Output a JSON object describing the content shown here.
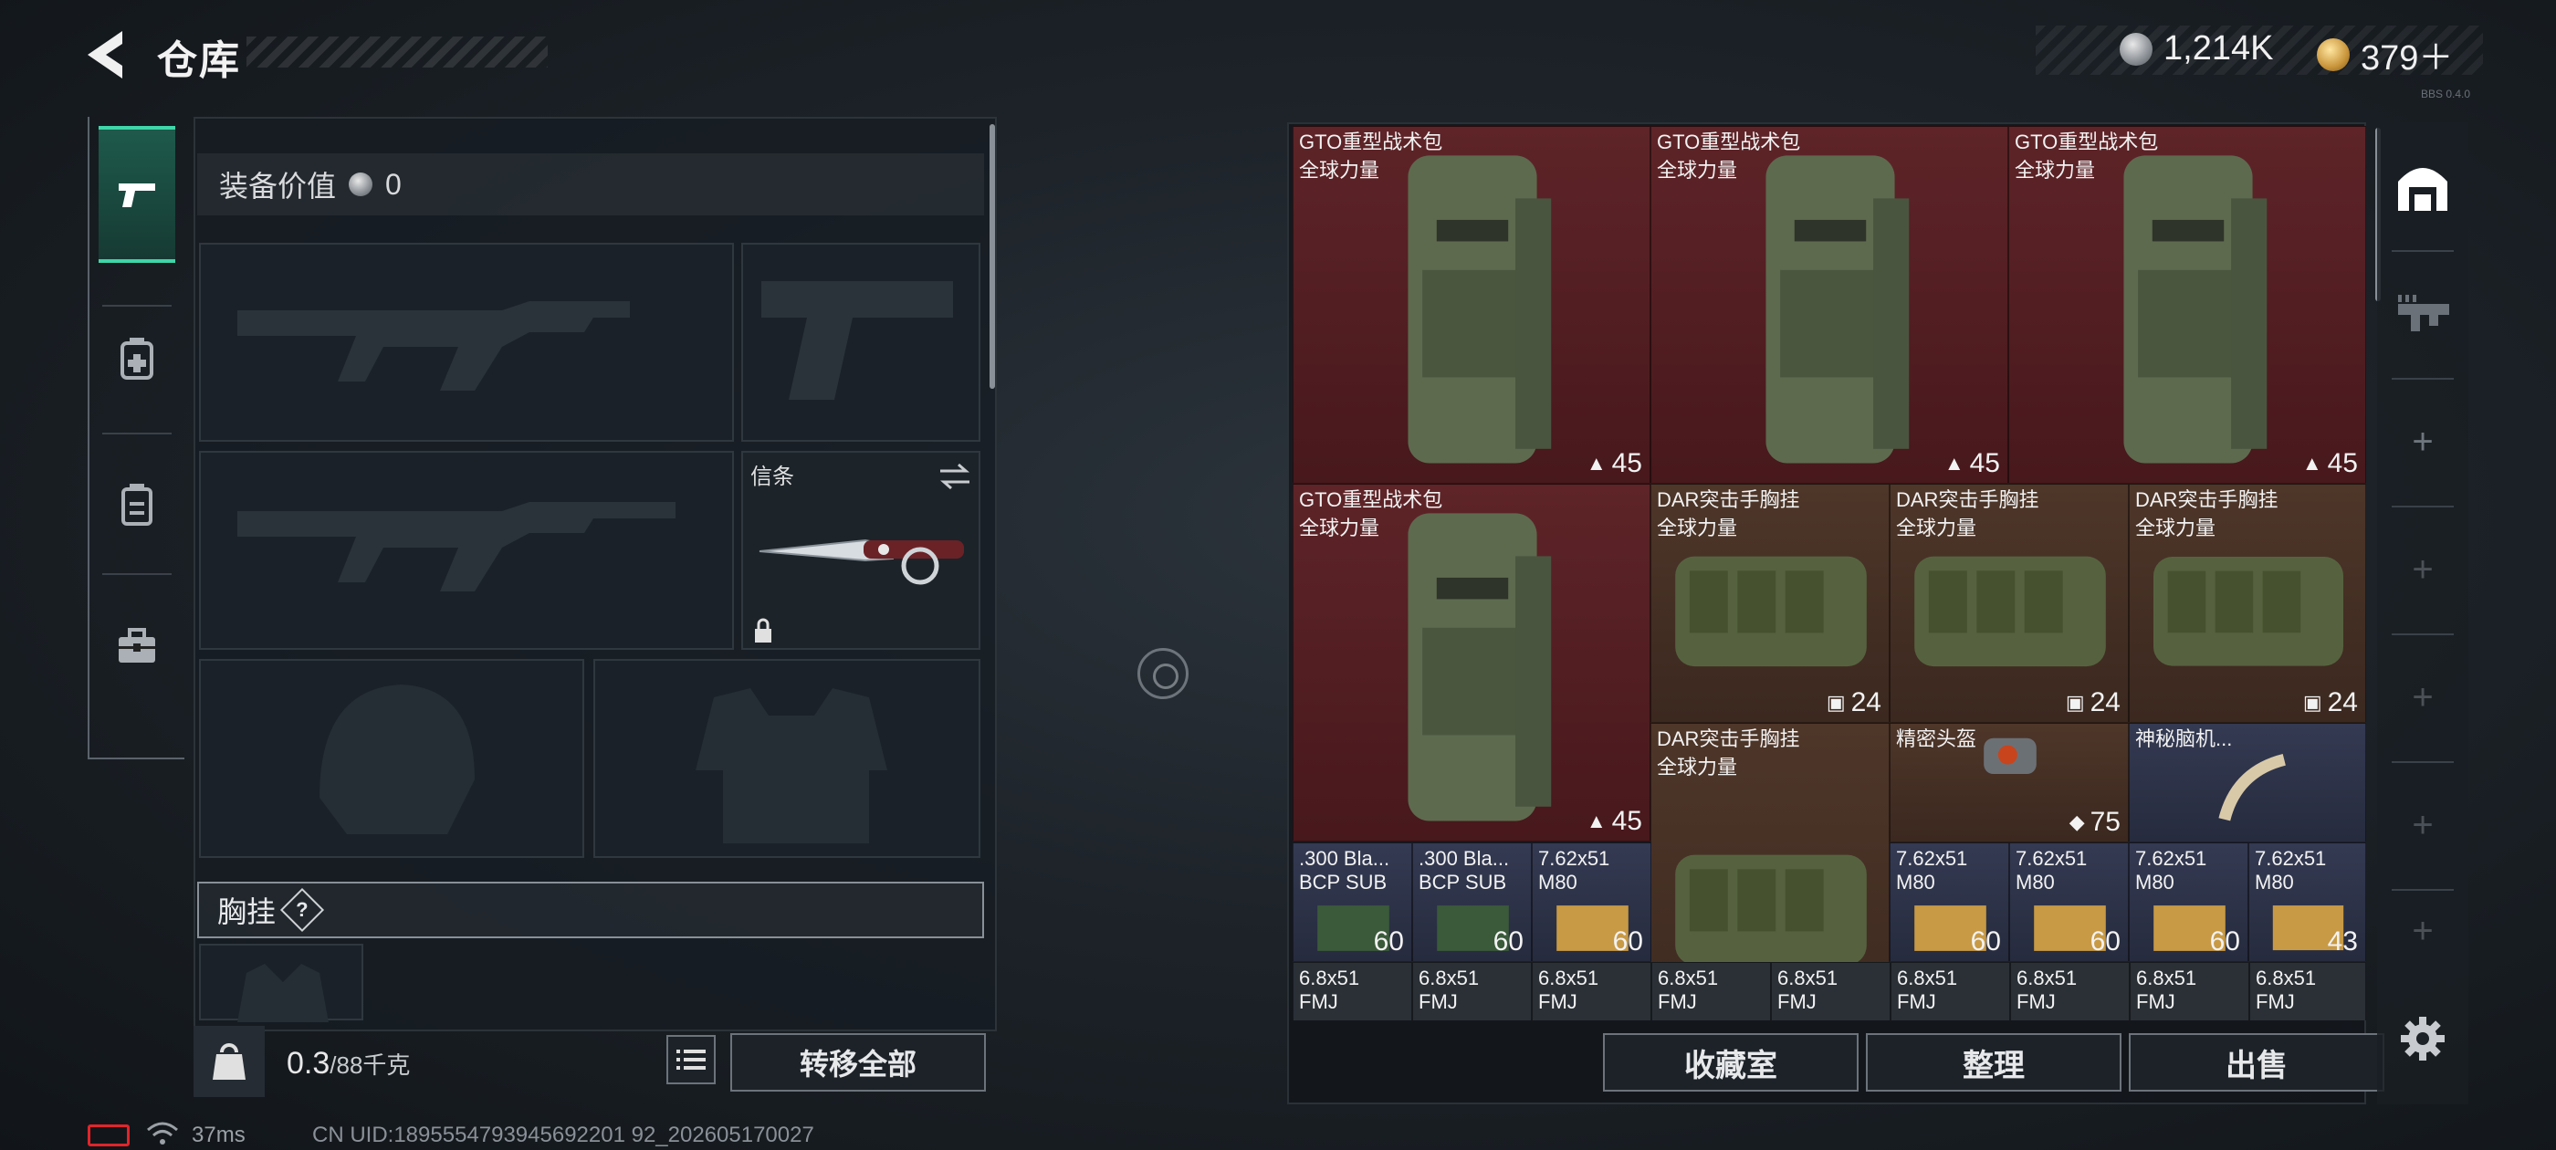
{
  "header": {
    "title": "仓库",
    "currency": [
      {
        "icon": "silver-coin-icon",
        "value": "1,214K"
      },
      {
        "icon": "gold-coin-icon",
        "value": "379＋"
      }
    ],
    "version": "BBS 0.4.0"
  },
  "left_nav": [
    {
      "icon": "pistol-icon",
      "active": true
    },
    {
      "icon": "medkit-bag-icon",
      "active": false
    },
    {
      "icon": "backpack-icon",
      "active": false
    },
    {
      "icon": "toolbox-icon",
      "active": false
    }
  ],
  "loadout": {
    "equip_value_label": "装备价值",
    "equip_value": "0",
    "melee_label": "信条",
    "chest_rig_label": "胸挂",
    "help_mark": "?",
    "weight_current": "0.3",
    "weight_capacity": "/88千克",
    "transfer_all": "转移全部"
  },
  "storage": {
    "items": [
      {
        "name": "GTO重型战术包",
        "sub": "全球力量",
        "count": "45",
        "count_icon": "backpack-capacity-icon",
        "bg": "red"
      },
      {
        "name": "GTO重型战术包",
        "sub": "全球力量",
        "count": "45",
        "count_icon": "backpack-capacity-icon",
        "bg": "red"
      },
      {
        "name": "GTO重型战术包",
        "sub": "全球力量",
        "count": "45",
        "count_icon": "backpack-capacity-icon",
        "bg": "red"
      },
      {
        "name": "GTO重型战术包",
        "sub": "全球力量",
        "count": "45",
        "count_icon": "backpack-capacity-icon",
        "bg": "red"
      },
      {
        "name": "DAR突击手胸挂",
        "sub": "全球力量",
        "count": "24",
        "count_icon": "vest-capacity-icon",
        "bg": "brown"
      },
      {
        "name": "DAR突击手胸挂",
        "sub": "全球力量",
        "count": "24",
        "count_icon": "vest-capacity-icon",
        "bg": "brown"
      },
      {
        "name": "DAR突击手胸挂",
        "sub": "全球力量",
        "count": "24",
        "count_icon": "vest-capacity-icon",
        "bg": "brown"
      },
      {
        "name": "DAR突击手胸挂",
        "sub": "全球力量",
        "count": "24",
        "count_icon": "vest-capacity-icon",
        "bg": "brown"
      },
      {
        "name": "精密头盔",
        "sub": "",
        "count": "75",
        "count_icon": "armor-durability-icon",
        "bg": "brown"
      },
      {
        "name": "神秘脑机...",
        "sub": "",
        "count": "",
        "count_icon": "",
        "bg": "blue"
      },
      {
        "name": ".300 Bla...",
        "sub": "BCP SUB",
        "count": "60",
        "bg": "blue"
      },
      {
        "name": ".300 Bla...",
        "sub": "BCP SUB",
        "count": "60",
        "bg": "blue"
      },
      {
        "name": "7.62x51",
        "sub": "M80",
        "count": "60",
        "bg": "blue"
      },
      {
        "name": "7.62x51",
        "sub": "M80",
        "count": "60",
        "bg": "blue"
      },
      {
        "name": "7.62x51",
        "sub": "M80",
        "count": "60",
        "bg": "blue"
      },
      {
        "name": "7.62x51",
        "sub": "M80",
        "count": "60",
        "bg": "blue"
      },
      {
        "name": "7.62x51",
        "sub": "M80",
        "count": "43",
        "bg": "blue"
      },
      {
        "name": "6.8x51",
        "sub": "FMJ",
        "bg": "gray"
      },
      {
        "name": "6.8x51",
        "sub": "FMJ",
        "bg": "gray"
      },
      {
        "name": "6.8x51",
        "sub": "FMJ",
        "bg": "gray"
      },
      {
        "name": "6.8x51",
        "sub": "FMJ",
        "bg": "gray"
      },
      {
        "name": "6.8x51",
        "sub": "FMJ",
        "bg": "gray"
      },
      {
        "name": "6.8x51",
        "sub": "FMJ",
        "bg": "gray"
      },
      {
        "name": "6.8x51",
        "sub": "FMJ",
        "bg": "gray"
      },
      {
        "name": "6.8x51",
        "sub": "FMJ",
        "bg": "gray"
      },
      {
        "name": "6.8x51",
        "sub": "FMJ",
        "bg": "gray"
      }
    ],
    "buttons": [
      "收藏室",
      "整理",
      "出售"
    ]
  },
  "right_rail": [
    {
      "icon": "warehouse-icon",
      "active": true
    },
    {
      "icon": "weapon-rack-icon",
      "active": false
    },
    {
      "icon": "plus-icon"
    },
    {
      "icon": "plus-icon"
    },
    {
      "icon": "plus-icon"
    },
    {
      "icon": "plus-icon"
    },
    {
      "icon": "plus-icon"
    }
  ],
  "status_bar": {
    "ping": "37ms",
    "uid": "CN UID:1895554793945692201 92_202605170027"
  }
}
